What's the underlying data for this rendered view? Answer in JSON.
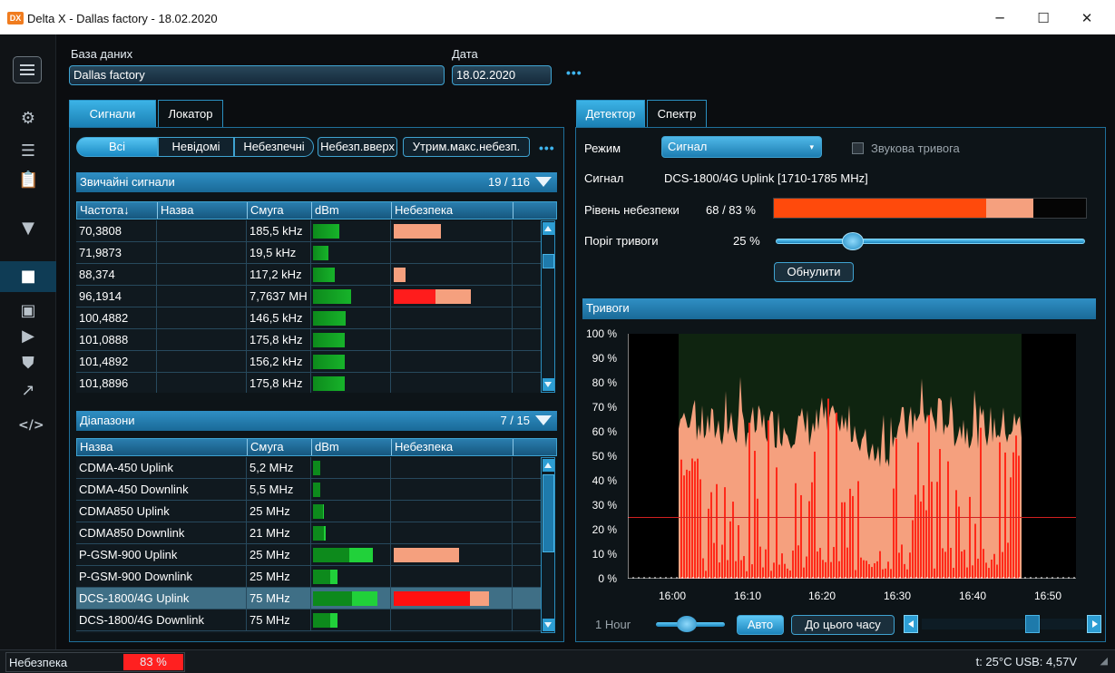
{
  "window": {
    "title": "Delta X - Dallas factory - 18.02.2020",
    "logo": "DX",
    "minimize": "─",
    "maximize": "☐",
    "close": "✕"
  },
  "sidebar": {
    "icons": [
      "menu-icon",
      "gear-icon",
      "list-icon",
      "clipboard-icon",
      "signal-icon",
      "stop-icon",
      "image-icon",
      "play-icon",
      "shield-icon",
      "trend-icon",
      "code-icon"
    ]
  },
  "header": {
    "db_label": "База даних",
    "db_value": "Dallas factory",
    "date_label": "Дата",
    "date_value": "18.02.2020",
    "more": "•••"
  },
  "left_tabs": [
    "Сигнали",
    "Локатор"
  ],
  "filters": {
    "items": [
      "Всі",
      "Невідомі",
      "Небезпечні",
      "Небезп.вверх",
      "Утрим.макс.небезп."
    ],
    "more": "•••"
  },
  "signals": {
    "title": "Звичайні сигнали",
    "count": "19 / 116",
    "columns": [
      "Частота↓",
      "Назва",
      "Смуга",
      "dBm",
      "Небезпека"
    ],
    "rows": [
      {
        "freq": "70,3808",
        "name": "",
        "band": "185,5 kHz",
        "dbm": 0.35,
        "danger": [
          0,
          0.4
        ]
      },
      {
        "freq": "71,9873",
        "name": "",
        "band": "19,5 kHz",
        "dbm": 0.2,
        "danger": [
          0,
          0
        ]
      },
      {
        "freq": "88,374",
        "name": "",
        "band": "117,2 kHz",
        "dbm": 0.28,
        "danger": [
          0,
          0.1
        ]
      },
      {
        "freq": "96,1914",
        "name": "",
        "band": "7,7637 MH",
        "dbm": 0.5,
        "danger": [
          0.35,
          0.3
        ]
      },
      {
        "freq": "100,4882",
        "name": "",
        "band": "146,5 kHz",
        "dbm": 0.43,
        "danger": [
          0,
          0
        ]
      },
      {
        "freq": "101,0888",
        "name": "",
        "band": "175,8 kHz",
        "dbm": 0.42,
        "danger": [
          0,
          0
        ]
      },
      {
        "freq": "101,4892",
        "name": "",
        "band": "156,2 kHz",
        "dbm": 0.42,
        "danger": [
          0,
          0
        ]
      },
      {
        "freq": "101,8896",
        "name": "",
        "band": "175,8 kHz",
        "dbm": 0.42,
        "danger": [
          0,
          0
        ]
      }
    ]
  },
  "ranges": {
    "title": "Діапазони",
    "count": "7 / 15",
    "columns": [
      "Назва",
      "Смуга",
      "dBm",
      "Небезпека"
    ],
    "rows": [
      {
        "name": "CDMA-450 Uplink",
        "band": "5,2 MHz",
        "dbm": 0.09,
        "danger": [
          0,
          0
        ]
      },
      {
        "name": "CDMA-450 Downlink",
        "band": "5,5 MHz",
        "dbm": 0.09,
        "danger": [
          0,
          0
        ]
      },
      {
        "name": "CDMA850 Uplink",
        "band": "25 MHz",
        "dbm": 0.14,
        "danger": [
          0,
          0
        ]
      },
      {
        "name": "CDMA850 Downlink",
        "band": "21 MHz",
        "dbm": 0.17,
        "danger": [
          0,
          0
        ]
      },
      {
        "name": "P-GSM-900 Uplink",
        "band": "25 MHz",
        "dbm": 0.78,
        "danger": [
          0,
          0.86
        ]
      },
      {
        "name": "P-GSM-900 Downlink",
        "band": "25 MHz",
        "dbm": 0.32,
        "danger": [
          0,
          0
        ]
      },
      {
        "name": "DCS-1800/4G Uplink",
        "band": "75 MHz",
        "dbm": 0.85,
        "danger": [
          1.0,
          0.25
        ],
        "selected": true
      },
      {
        "name": "DCS-1800/4G Downlink",
        "band": "75 MHz",
        "dbm": 0.32,
        "danger": [
          0,
          0
        ]
      }
    ]
  },
  "right_tabs": [
    "Детектор",
    "Спектр"
  ],
  "detector": {
    "mode_label": "Режим",
    "mode_value": "Сигнал",
    "sound_label": "Звукова тривога",
    "signal_label": "Сигнал",
    "signal_value": "DCS-1800/4G Uplink [1710-1785 MHz]",
    "level_label": "Рівень небезпеки",
    "level_value": "68 / 83 %",
    "level_fraction": 0.68,
    "max_fraction": 0.83,
    "threshold_label": "Поріг тривоги",
    "threshold_value": "25 %",
    "threshold_fraction": 0.25,
    "reset_label": "Обнулити"
  },
  "alarms": {
    "title": "Тривоги"
  },
  "chart_data": {
    "type": "area",
    "y_ticks": [
      "100 %",
      "90 %",
      "80 %",
      "70 %",
      "60 %",
      "50 %",
      "40 %",
      "30 %",
      "20 %",
      "10 %",
      "0 %"
    ],
    "x_ticks": [
      "16:00",
      "16:10",
      "16:20",
      "16:30",
      "16:40",
      "16:50"
    ],
    "ylim": [
      0,
      100
    ],
    "threshold": 25,
    "colors": {
      "danger_max": "#f5a07e",
      "danger": "#ff2a1a",
      "threshold": "#d02020",
      "active_bg": "#0f2410"
    }
  },
  "bottom_controls": {
    "range_label": "1 Hour",
    "auto_label": "Авто",
    "now_label": "До цього часу"
  },
  "status": {
    "danger_label": "Небезпека",
    "danger_value": "83 %",
    "right": "t: 25°C  USB: 4,57V"
  }
}
